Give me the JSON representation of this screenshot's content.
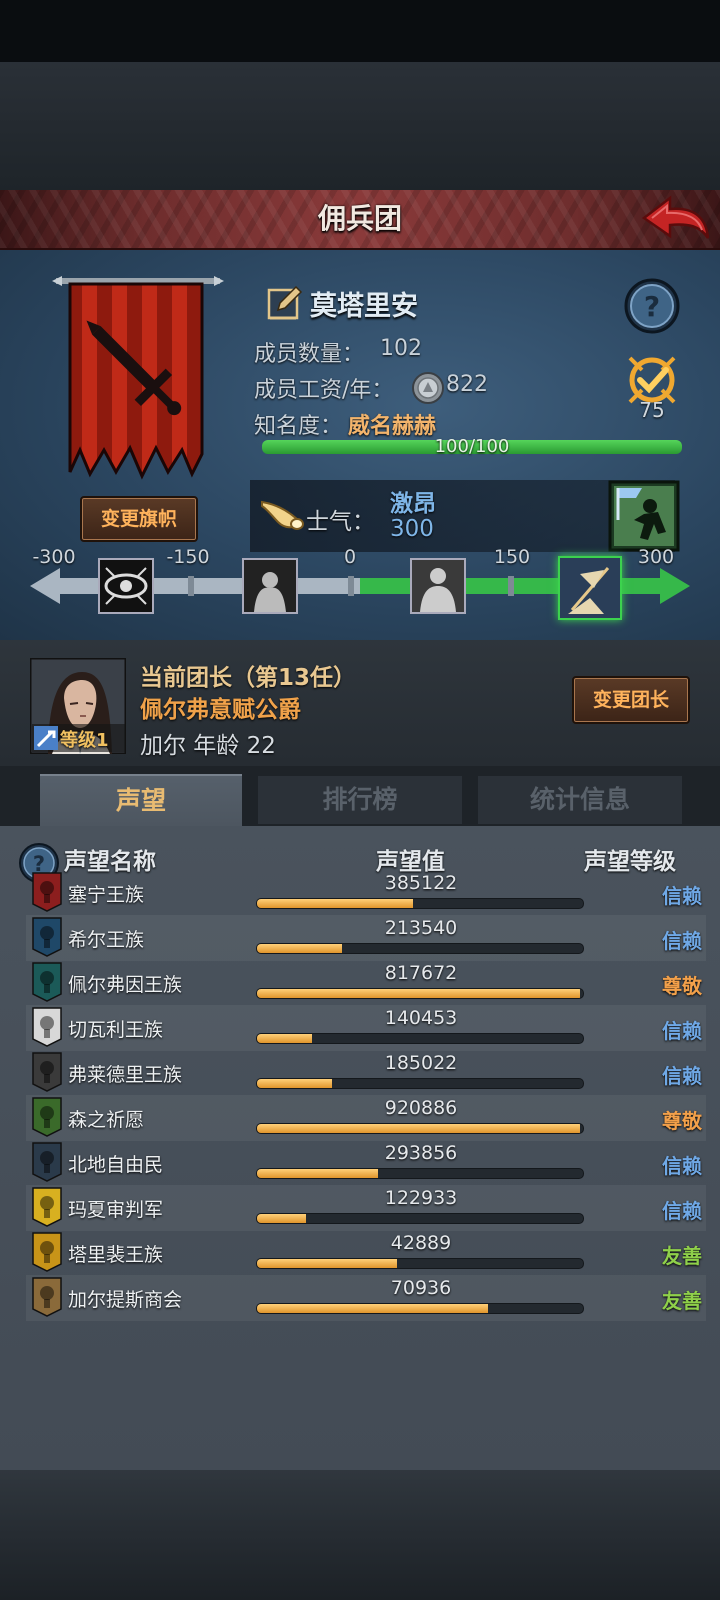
{
  "title": "佣兵团",
  "mercenary": {
    "name": "莫塔里安",
    "member_count_label": "成员数量：",
    "member_count": "102",
    "salary_label": "成员工资/年：",
    "salary": "822",
    "renown_label": "知名度：",
    "renown_state": "威名赫赫",
    "renown_progress_text": "100/100",
    "renown_progress": 1.0,
    "badge_value": "75",
    "change_banner_label": "变更旗帜"
  },
  "morale": {
    "label": "士气：",
    "state": "激昂",
    "value": "300",
    "scale_ticks": [
      "-300",
      "-150",
      "0",
      "150",
      "300"
    ],
    "fill_fraction": 0.5
  },
  "leader": {
    "title": "当前团长（第13任）",
    "rank": "佩尔弗意赋公爵",
    "name_age": "加尔  年龄 22",
    "level_label": "等级1",
    "change_leader_label": "变更团长"
  },
  "tabs": [
    {
      "label": "声望",
      "active": true
    },
    {
      "label": "排行榜",
      "active": false
    },
    {
      "label": "统计信息",
      "active": false
    }
  ],
  "list_headers": {
    "name": "声望名称",
    "value": "声望值",
    "level": "声望等级"
  },
  "factions": [
    {
      "name": "塞宁王族",
      "value": "385122",
      "fill": 0.48,
      "level": "信赖",
      "level_color": "#6fa8e6",
      "emblem_color": "#8c1e1e"
    },
    {
      "name": "希尔王族",
      "value": "213540",
      "fill": 0.26,
      "level": "信赖",
      "level_color": "#6fa8e6",
      "emblem_color": "#1f4868"
    },
    {
      "name": "佩尔弗因王族",
      "value": "817672",
      "fill": 0.99,
      "level": "尊敬",
      "level_color": "#f2a04a",
      "emblem_color": "#1b5a58"
    },
    {
      "name": "切瓦利王族",
      "value": "140453",
      "fill": 0.17,
      "level": "信赖",
      "level_color": "#6fa8e6",
      "emblem_color": "#d8d8d8"
    },
    {
      "name": "弗莱德里王族",
      "value": "185022",
      "fill": 0.23,
      "level": "信赖",
      "level_color": "#6fa8e6",
      "emblem_color": "#3a3a3a"
    },
    {
      "name": "森之祈愿",
      "value": "920886",
      "fill": 0.99,
      "level": "尊敬",
      "level_color": "#f2a04a",
      "emblem_color": "#3a6a2a"
    },
    {
      "name": "北地自由民",
      "value": "293856",
      "fill": 0.37,
      "level": "信赖",
      "level_color": "#6fa8e6",
      "emblem_color": "#2a3a4a"
    },
    {
      "name": "玛夏审判军",
      "value": "122933",
      "fill": 0.15,
      "level": "信赖",
      "level_color": "#6fa8e6",
      "emblem_color": "#d8b020"
    },
    {
      "name": "塔里裴王族",
      "value": "42889",
      "fill": 0.43,
      "level": "友善",
      "level_color": "#8fd04a",
      "emblem_color": "#c89418"
    },
    {
      "name": "加尔提斯商会",
      "value": "70936",
      "fill": 0.71,
      "level": "友善",
      "level_color": "#8fd04a",
      "emblem_color": "#8a6a3a"
    }
  ]
}
